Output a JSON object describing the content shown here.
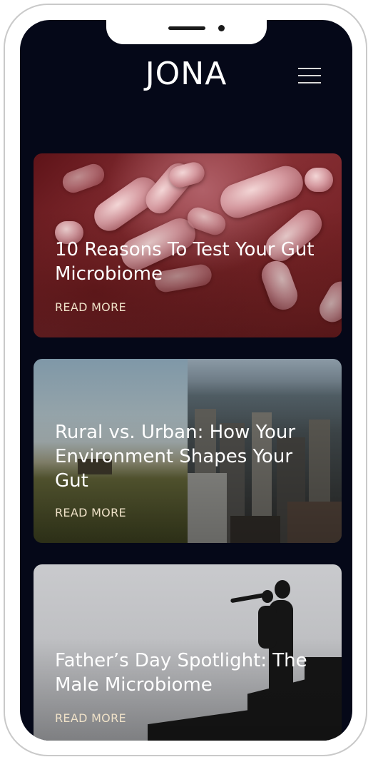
{
  "header": {
    "logo_text": "JONA",
    "menu_icon": "hamburger-menu-icon"
  },
  "articles": [
    {
      "title": "10 Reasons To Test Your Gut Microbiome",
      "link": "READ MORE",
      "image": "bacteria-microscope-image"
    },
    {
      "title": "Rural vs. Urban: How Your Environment Shapes Your Gut",
      "link": "READ MORE",
      "image": "rural-urban-split-image"
    },
    {
      "title": "Father’s Day Spotlight: The Male Microbiome",
      "link": "READ MORE",
      "image": "father-child-silhouette-image"
    }
  ],
  "colors": {
    "background": "#050818",
    "text": "#ffffff",
    "link": "#efe1c8"
  }
}
